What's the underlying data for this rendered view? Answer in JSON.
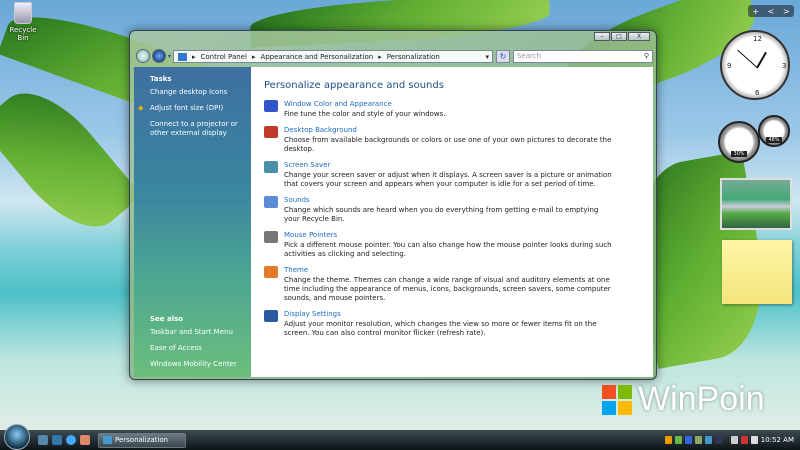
{
  "desktop": {
    "recycle_bin": "Recycle Bin"
  },
  "window": {
    "caption_buttons": {
      "minimize": "–",
      "maximize": "□",
      "close": "X"
    },
    "breadcrumb": [
      "Control Panel",
      "Appearance and Personalization",
      "Personalization"
    ],
    "search_placeholder": "Search"
  },
  "sidebar": {
    "tasks_heading": "Tasks",
    "tasks": [
      "Change desktop icons",
      "Adjust font size (DPI)",
      "Connect to a projector or other external display"
    ],
    "see_also_heading": "See also",
    "see_also": [
      "Taskbar and Start Menu",
      "Ease of Access",
      "Windows Mobility Center"
    ]
  },
  "main": {
    "title": "Personalize appearance and sounds",
    "items": [
      {
        "link": "Window Color and Appearance",
        "desc": "Fine tune the color and style of your windows.",
        "icon": "window-color-icon",
        "color": "#3355cc"
      },
      {
        "link": "Desktop Background",
        "desc": "Choose from available backgrounds or colors or use one of your own pictures to decorate the desktop.",
        "icon": "desktop-background-icon",
        "color": "#c0392b"
      },
      {
        "link": "Screen Saver",
        "desc": "Change your screen saver or adjust when it displays. A screen saver is a picture or animation that covers your screen and appears when your computer is idle for a set period of time.",
        "icon": "screen-saver-icon",
        "color": "#4a8fa8"
      },
      {
        "link": "Sounds",
        "desc": "Change which sounds are heard when you do everything from getting e-mail to emptying your Recycle Bin.",
        "icon": "sounds-icon",
        "color": "#5b8dd6"
      },
      {
        "link": "Mouse Pointers",
        "desc": "Pick a different mouse pointer. You can also change how the mouse pointer looks during such activities as clicking and selecting.",
        "icon": "mouse-pointer-icon",
        "color": "#777777"
      },
      {
        "link": "Theme",
        "desc": "Change the theme. Themes can change a wide range of visual and auditory elements at one time including the appearance of menus, icons, backgrounds, screen savers, some computer sounds, and mouse pointers.",
        "icon": "theme-icon",
        "color": "#e07b2a"
      },
      {
        "link": "Display Settings",
        "desc": "Adjust your monitor resolution, which changes the view so more or fewer items fit on the screen. You can also control monitor flicker (refresh rate).",
        "icon": "display-settings-icon",
        "color": "#2c5aa0"
      }
    ]
  },
  "gadgets": {
    "cpu": "30%",
    "mem": "48%",
    "sidebar_controls": [
      "+",
      "<",
      ">"
    ]
  },
  "watermark": "WinPoin",
  "taskbar": {
    "task": "Personalization",
    "clock": "10:52 AM"
  }
}
